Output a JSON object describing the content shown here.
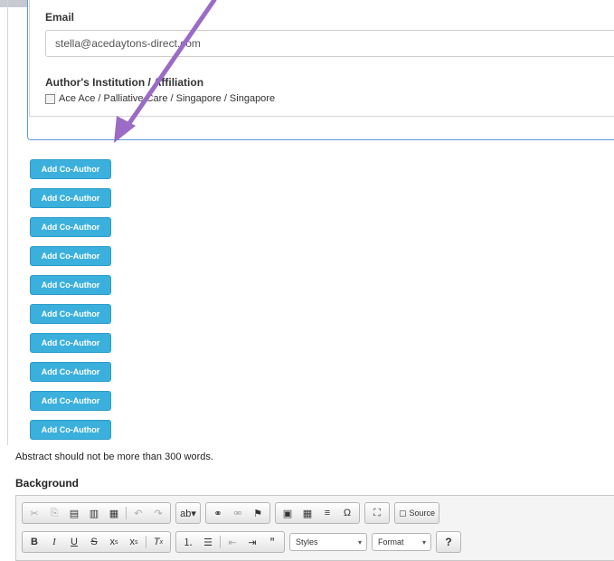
{
  "author": {
    "email_label": "Email",
    "email_value": "stella@acedaytons-direct.com",
    "affiliation_label": "Author's Institution / Affiliation",
    "affiliation_option": "Ace Ace / Palliative Care / Singapore / Singapore"
  },
  "coauthor_buttons": [
    "Add Co-Author",
    "Add Co-Author",
    "Add Co-Author",
    "Add Co-Author",
    "Add Co-Author",
    "Add Co-Author",
    "Add Co-Author",
    "Add Co-Author",
    "Add Co-Author",
    "Add Co-Author"
  ],
  "abstract_note": "Abstract should not be more than 300 words.",
  "background_label": "Background",
  "editor": {
    "source_label": "Source",
    "styles_label": "Styles",
    "format_label": "Format",
    "help_label": "?"
  },
  "colors": {
    "button": "#3cb0dc",
    "panel_border": "#5b9bd5",
    "arrow": "#9b6bc6"
  },
  "icons": [
    "cut-icon",
    "copy-icon",
    "paste-icon",
    "paste-text-icon",
    "paste-word-icon",
    "undo-icon",
    "redo-icon",
    "spellcheck-icon",
    "link-icon",
    "unlink-icon",
    "anchor-icon",
    "image-icon",
    "table-icon",
    "horizontal-line-icon",
    "special-char-icon",
    "maximize-icon",
    "source-icon",
    "bold-icon",
    "italic-icon",
    "underline-icon",
    "strike-icon",
    "subscript-icon",
    "superscript-icon",
    "remove-format-icon",
    "numbered-list-icon",
    "bulleted-list-icon",
    "outdent-icon",
    "indent-icon",
    "blockquote-icon"
  ]
}
